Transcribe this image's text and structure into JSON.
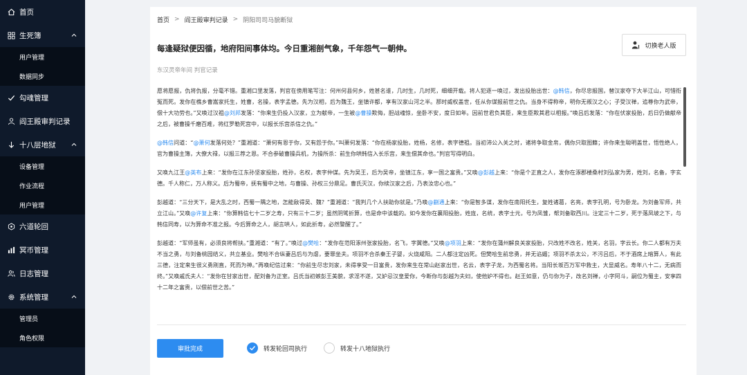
{
  "sidebar": {
    "items": [
      {
        "label": "首页",
        "icon": "home-icon"
      },
      {
        "label": "生死簿",
        "icon": "grid-icon",
        "expanded": true,
        "children": [
          "用户管理",
          "数据同步"
        ]
      },
      {
        "label": "勾魂管理",
        "icon": "check-icon"
      },
      {
        "label": "阎王殿审判记录",
        "icon": "user-icon"
      },
      {
        "label": "十八层地狱",
        "icon": "arrow-down-icon",
        "expanded": true,
        "children": [
          "设备管理",
          "作业流程",
          "用户管理"
        ]
      },
      {
        "label": "六道轮回",
        "icon": "cycle-icon"
      },
      {
        "label": "冥币管理",
        "icon": "bars-icon"
      },
      {
        "label": "日志管理",
        "icon": "users-icon"
      },
      {
        "label": "系统管理",
        "icon": "gear-icon",
        "expanded": true,
        "children": [
          "管理员",
          "角色权限"
        ]
      }
    ]
  },
  "breadcrumb": [
    "首页",
    "阎王殿审判记录",
    "阴阳司司马貌断狱"
  ],
  "page_title": "每逢疑狱便因循，地府阳间事体均。今日重湘剖气象，千年怨气一朝伸。",
  "switch_button": "切换老人版",
  "subtitle": "东汉灵帝年间 判官记录",
  "paragraphs": [
    [
      {
        "t": "愿将愿报，仇将仇报，分毫不错。重湘口里发落，判官在傍用笔写注：何州何县何乡，姓甚名谁，几时生，几时死，细细开载。将人犯逐一唤过，发出投胎出世："
      },
      {
        "t": "@韩信",
        "hl": true
      },
      {
        "t": "，你尽忠报国，替汉家夺下大半江山，可惜衔冤而死。发你在樵乡曹嵩家托生，姓曹，名操，表字孟德。先为汉相，后为魏王，坐镇许都，享有汉家山河之半。那时威权盖世，任从你谋报前世之仇。当身不得称帝，明你无叛汉之心；子受汉禅，追尊你为武帝，偿十大功劳也。”又唤过汉祖"
      },
      {
        "t": "@刘邦",
        "hl": true
      },
      {
        "t": "发落：“你来生仍投入汉家，立为献帝，一生被"
      },
      {
        "t": "@曹操",
        "hl": true
      },
      {
        "t": "欺侮，胆战魂惊，坐卧不安，度日如年。因前世君负其臣，来生臣欺其君以相报。”唤吕后发落：“你在伏家投胎，后日仍做献帝之后，被曹操千磨百难，将红罗勒死宫中，以报长乐宫杀信之仇。”"
      }
    ],
    [
      {
        "t": "@韩信",
        "hl": true
      },
      {
        "t": "问道：“"
      },
      {
        "t": "@萧何",
        "hl": true
      },
      {
        "t": "发落何处？”重湘道：“萧何有恩于你，又有怨于你。”叫萧何发落：“你在杨家投胎，姓杨，名修，表字德祖。当初沛公入关之时，诸将争取金帛，偶你只取图籍；许你来生聪明盖世，悟性绝人，官为曹操主簿，大僚大禄，以报三荐之恩。不合参破曹操兵机，为操所杀：前生你哄韩信入长乐宫，来生偿其命也。”判官写得明白。"
      }
    ],
    [
      {
        "t": "又唤九江王"
      },
      {
        "t": "@英布",
        "hl": true
      },
      {
        "t": "上来：“发你在江东孙坚家投胎，姓孙，名权，表字仲谋。先为吴王，后为吴帝，坐镇江东，享一国之富贵。”又唤"
      },
      {
        "t": "@彭越",
        "hl": true
      },
      {
        "t": "上来：“你是个正直之人，发你在涿郡楼桑村刘弘家为男，姓刘，名备，字玄德。千人称仁，万人称义。后为蜀帝，抚有蜀中之地，与曹操、孙权三分鼎足。曹氏灭汉，你续汉家之后，乃表汝忠心也。”"
      }
    ],
    [
      {
        "t": "彭越道：“三分天下，是大乱之时，西蜀一隅之地，怎能敌得吴、魏？”重湘道：“我判几个人扶助你就是。”乃唤"
      },
      {
        "t": "@蒯通",
        "hl": true
      },
      {
        "t": "上来：“你是智多谋，发你在南阳托生，复姓诸葛，名亮，表字孔明，号为卧龙。为刘备军师，共立江山。”又唤"
      },
      {
        "t": "@许复",
        "hl": true
      },
      {
        "t": "上来：“你算韩信七十二岁之寿，只有三十二岁；虽然阴骘折算，也是命中该载的。如今发你在襄阳投胎，姓庞，名统，表字士元，号为凤雏，帮刘备取西川。注定三十二岁，死于落凤坡之下，与韩信同寿，以为算命不准之报。今后算命之人，胡言哄人，如此折寿，必然警醒了。”"
      }
    ],
    [
      {
        "t": "彭越道：“军师虽有，必须良将帮扶。”重湘道：“有了。”唤过"
      },
      {
        "t": "@樊哙",
        "hl": true
      },
      {
        "t": "：“发你在范阳涿州张家投胎，名飞，字翼德。”又唤"
      },
      {
        "t": "@项羽",
        "hl": true
      },
      {
        "t": "上来：“发你在蒲州解良关家投胎，只改姓不改名，姓关，名羽，字云长。你二人都有万夫不当之勇，与刘备桃园结义，共立基业。樊哙不合纵妻吕后与为虐，要罪坐夫。项羽不合杀秦王子婴，火烧咸阳。二人都注定凶死。但樊哙生前忠勇，并无谄媚；项羽不杀太公，不污吕后，不于酒席上暗算人，有此三德，注定来生很义勇刚直，死而为神。”再唤纪信过来：“你前生尽忠刘家，未得享受一日富贵，发你来生在常山赵家出世，名云，表字子龙，为西蜀名将。当阳长坂百万军中救主，大显威名。寿年八十二，无病而终。”又唤戚氏夫人：“发你在甘家出世，配刘备为正室。吕氏当初嫉彭王美貌，求淫不遂，又妒忌汉皇爱你，今断你与彭越为夫妇，使他妒不得也。赵王如意，仍与你为子，改名刘禅，小字阿斗，嗣位为蜀主，安享四十二年之富贵，以偿前世之苦。”"
      }
    ]
  ],
  "submit_button": "审批完成",
  "radios": [
    {
      "label": "转发轮回司执行",
      "checked": true
    },
    {
      "label": "转发十八地狱执行",
      "checked": false
    }
  ],
  "colors": {
    "accent": "#2d8cf0",
    "sidebar_bg": "#0f1a2b",
    "highlight": "#2d8cf0"
  }
}
